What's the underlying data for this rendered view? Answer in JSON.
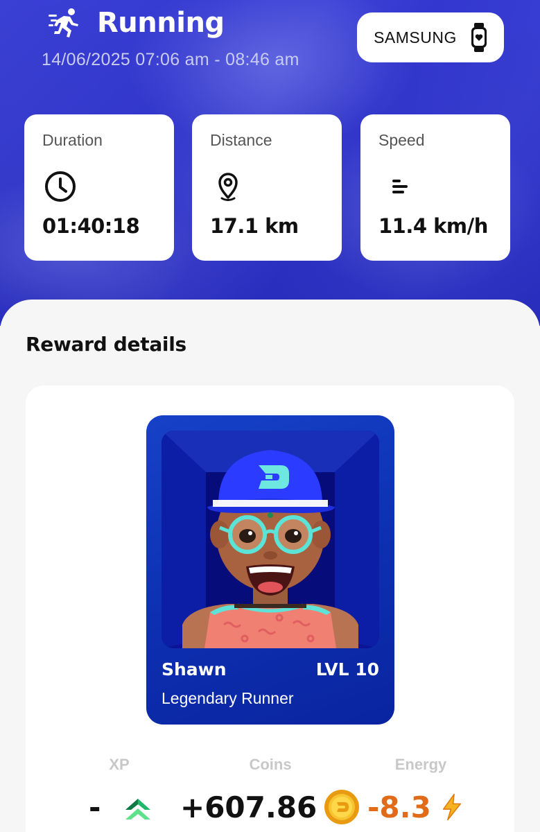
{
  "activity": {
    "title": "Running",
    "datetime": "14/06/2025 07:06 am - 08:46 am",
    "icon": "running-person-icon"
  },
  "device": {
    "label": "SAMSUNG",
    "icon": "smartwatch-icon"
  },
  "stats": [
    {
      "label": "Duration",
      "value": "01:40:18",
      "icon": "clock-icon"
    },
    {
      "label": "Distance",
      "value": "17.1 km",
      "icon": "location-pin-icon"
    },
    {
      "label": "Speed",
      "value": "11.4 km/h",
      "icon": "speed-lines-icon"
    }
  ],
  "reward_section": {
    "title": "Reward details"
  },
  "avatar": {
    "name": "Shawn",
    "level": "LVL 10",
    "rank": "Legendary Runner"
  },
  "rewards": [
    {
      "label": "XP",
      "value": "-",
      "icon": "xp-arrows-icon"
    },
    {
      "label": "Coins",
      "value": "+607.86",
      "icon": "coin-icon"
    },
    {
      "label": "Energy",
      "value": "-8.3",
      "icon": "lightning-icon"
    }
  ],
  "colors": {
    "primary": "#3438d6",
    "energy": "#e06b18",
    "coin": "#f5b71a",
    "xp": "#27c46a"
  }
}
